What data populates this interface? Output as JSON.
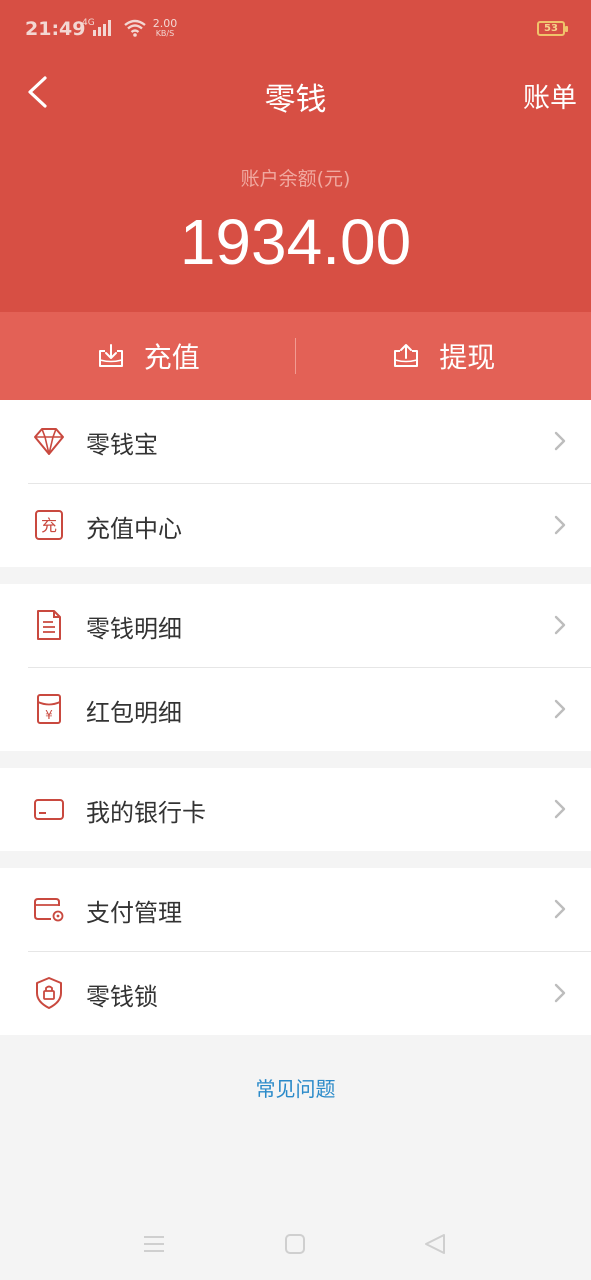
{
  "status_bar": {
    "time": "21:49",
    "network_type": "4G",
    "speed_value": "2.00",
    "speed_unit": "KB/S",
    "battery": "53"
  },
  "header": {
    "back_icon": "chevron-left-icon",
    "title": "零钱",
    "bill_label": "账单"
  },
  "balance": {
    "label": "账户余额(元)",
    "amount": "1934.00"
  },
  "actions": {
    "recharge_label": "充值",
    "recharge_icon": "download-tray-icon",
    "withdraw_label": "提现",
    "withdraw_icon": "upload-tray-icon"
  },
  "groups": [
    {
      "items": [
        {
          "label": "零钱宝",
          "icon": "diamond-icon"
        },
        {
          "label": "充值中心",
          "icon": "recharge-center-icon"
        }
      ]
    },
    {
      "items": [
        {
          "label": "零钱明细",
          "icon": "document-icon"
        },
        {
          "label": "红包明细",
          "icon": "red-envelope-icon"
        }
      ]
    },
    {
      "items": [
        {
          "label": "我的银行卡",
          "icon": "bank-card-icon"
        }
      ]
    },
    {
      "items": [
        {
          "label": "支付管理",
          "icon": "payment-manage-icon"
        },
        {
          "label": "零钱锁",
          "icon": "shield-lock-icon"
        }
      ]
    }
  ],
  "faq_label": "常见问题",
  "colors": {
    "header_red": "#d74f44",
    "action_bar_red": "#e36156",
    "icon_red": "#c9493f",
    "link_blue": "#2a8ac9"
  }
}
